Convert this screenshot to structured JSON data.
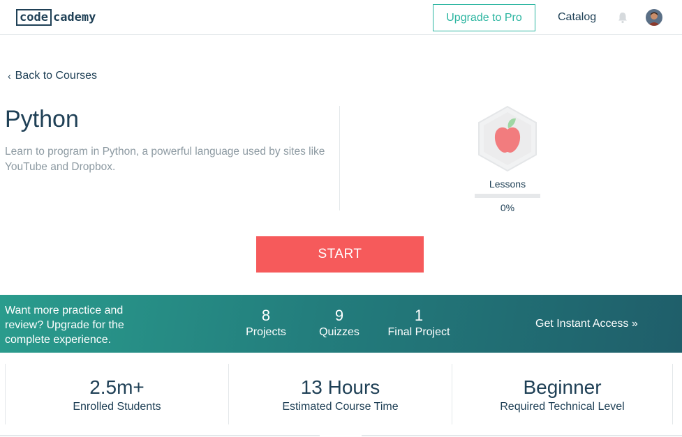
{
  "header": {
    "logo_left": "code",
    "logo_right": "cademy",
    "upgrade_label": "Upgrade to Pro",
    "catalog_label": "Catalog",
    "bell_icon": "bell-icon",
    "avatar_icon": "user-avatar"
  },
  "back_link": {
    "label": "Back to Courses",
    "icon": "chevron-left-icon"
  },
  "course": {
    "title": "Python",
    "description": "Learn to program in Python, a powerful language used by sites like YouTube and Dropbox.",
    "badge_icon": "apple-icon",
    "lessons_label": "Lessons",
    "progress_value": 0,
    "progress_label": "0%",
    "start_label": "START"
  },
  "promo": {
    "text": "Want more practice and review? Upgrade for the complete experience.",
    "stats": [
      {
        "number": "8",
        "label": "Projects"
      },
      {
        "number": "9",
        "label": "Quizzes"
      },
      {
        "number": "1",
        "label": "Final Project"
      }
    ],
    "access_label": "Get Instant Access »"
  },
  "info": [
    {
      "value": "2.5m+",
      "label": "Enrolled Students"
    },
    {
      "value": "13 Hours",
      "label": "Estimated Course Time"
    },
    {
      "value": "Beginner",
      "label": "Required Technical Level"
    }
  ],
  "colors": {
    "accent": "#2bb5a0",
    "start_button": "#f65a5b",
    "text_dark": "#1f4056",
    "text_muted": "#8d9aa2"
  }
}
